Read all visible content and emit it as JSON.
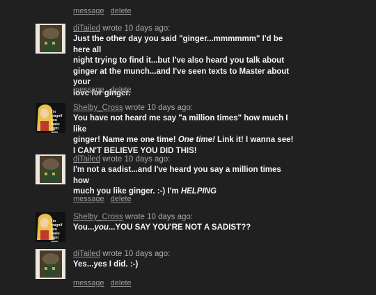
{
  "top_actions": {
    "message": "message",
    "delete": "delete"
  },
  "comments": [
    {
      "author": "diTailed",
      "meta": " wrote 10 days ago:",
      "avatar": "mouse-cowboy-avatar",
      "lines": [
        "Just the other day you said \"ginger...mmmmmm\" I'd be here all",
        "night trying to find it...but I've also heard you talk about",
        "ginger at the munch...and I've seen texts to Master about your",
        "love for ginger."
      ],
      "actions": {
        "message": "message",
        "delete": "delete"
      }
    },
    {
      "author": "Shelby_Cross",
      "meta": " wrote 10 days ago:",
      "avatar": "blonde-girl-avatar",
      "avatar_caption": [
        "I'm magnif",
        "you make",
        "right now"
      ],
      "line1_pre": "You have not heard me say \"a million times\" how much I like",
      "line2_pre": "ginger! Name me one time! ",
      "line2_em": "One time!",
      "line2_post": " Link it! I wanna see!",
      "line3": "I CAN'T BELIEVE YOU DID THIS!"
    },
    {
      "author": "diTailed",
      "meta": " wrote 10 days ago:",
      "avatar": "mouse-cowboy-avatar",
      "line1": "I'm not a sadist...and I've heard you say a million times how",
      "line2_pre": "much you like ginger. :-) I'm ",
      "line2_em": "HELPING",
      "actions": {
        "message": "message",
        "delete": "delete"
      }
    },
    {
      "author": "Shelby_Cross",
      "meta": " wrote 10 days ago:",
      "avatar": "blonde-girl-avatar",
      "avatar_caption": [
        "I'm magnif",
        "you make",
        "right now"
      ],
      "text_pre": "You...",
      "text_em": "you",
      "text_post": "...YOU SAY YOU'RE NOT A SADIST??"
    },
    {
      "author": "diTailed",
      "meta": " wrote 10 days ago:",
      "avatar": "mouse-cowboy-avatar",
      "text": "Yes...yes I did. :-)",
      "actions": {
        "message": "message",
        "delete": "delete"
      }
    }
  ]
}
